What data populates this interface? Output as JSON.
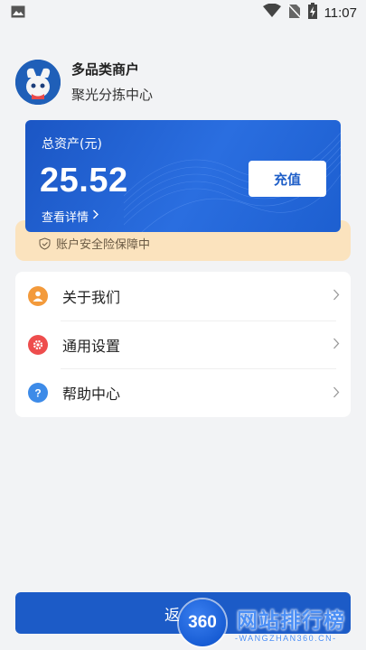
{
  "status_bar": {
    "time": "11:07",
    "left_icon": "image-icon",
    "icons": [
      "wifi-icon",
      "no-sim-icon",
      "battery-charging-icon"
    ]
  },
  "profile": {
    "name": "多品类商户",
    "subtitle": "聚光分拣中心",
    "avatar_icon": "mascot-avatar"
  },
  "asset_card": {
    "label": "总资产(元)",
    "value": "25.52",
    "detail_link": "查看详情",
    "recharge_label": "充值",
    "insurance_text": "账户安全险保障中",
    "colors": {
      "card": "#1f5fc8",
      "insurance_bg": "#fbe3be"
    }
  },
  "menu": {
    "items": [
      {
        "label": "关于我们",
        "icon": "user-icon",
        "color": "#f39a3b"
      },
      {
        "label": "通用设置",
        "icon": "settings-icon",
        "color": "#ee4d4d"
      },
      {
        "label": "帮助中心",
        "icon": "help-icon",
        "color": "#3d8be8"
      }
    ]
  },
  "bottom": {
    "return_label": "返"
  },
  "watermark": {
    "badge": "360",
    "title": "网站排行榜",
    "url": "-WANGZHAN360.CN-"
  }
}
